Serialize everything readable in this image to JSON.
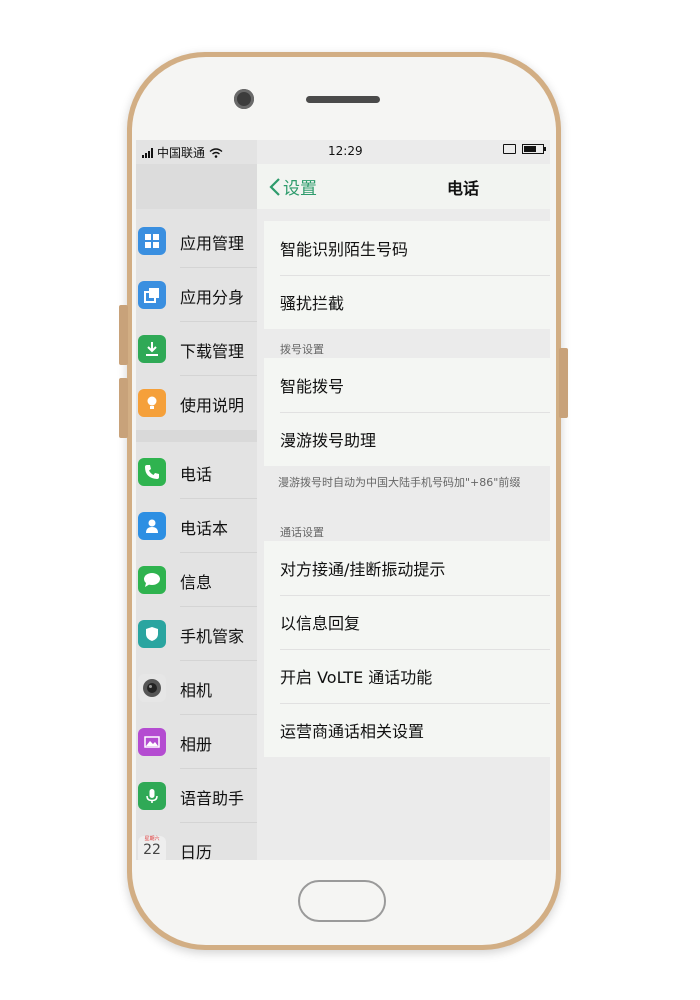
{
  "status_bar": {
    "carrier": "中国联通",
    "time": "12:29"
  },
  "sidebar": {
    "items": [
      {
        "label": "应用管理",
        "icon": "app-manager-icon",
        "color": "#3a8fe0"
      },
      {
        "label": "应用分身",
        "icon": "app-clone-icon",
        "color": "#3a8fe0"
      },
      {
        "label": "下载管理",
        "icon": "download-icon",
        "color": "#2fa956"
      },
      {
        "label": "使用说明",
        "icon": "lightbulb-icon",
        "color": "#f5a03a"
      },
      {
        "label": "电话",
        "icon": "phone-icon",
        "color": "#2fb34f"
      },
      {
        "label": "电话本",
        "icon": "contacts-icon",
        "color": "#2d8fe3"
      },
      {
        "label": "信息",
        "icon": "message-icon",
        "color": "#2fb34f"
      },
      {
        "label": "手机管家",
        "icon": "shield-icon",
        "color": "#2aa5a0"
      },
      {
        "label": "相机",
        "icon": "camera-icon",
        "color": "#555555"
      },
      {
        "label": "相册",
        "icon": "gallery-icon",
        "color": "#b44cd1"
      },
      {
        "label": "语音助手",
        "icon": "microphone-icon",
        "color": "#2fa956"
      },
      {
        "label": "日历",
        "icon": "calendar-icon",
        "color": "#eeeeee",
        "calendar_day": "22",
        "calendar_weekday": "星期六"
      }
    ]
  },
  "nav": {
    "back_label": "设置",
    "title": "电话"
  },
  "groups": {
    "top": [
      "智能识别陌生号码",
      "骚扰拦截"
    ],
    "dial_header": "拨号设置",
    "dial": [
      "智能拨号",
      "漫游拨号助理"
    ],
    "dial_hint": "漫游拨号时自动为中国大陆手机号码加\"+86\"前缀",
    "call_header": "通话设置",
    "call": [
      "对方接通/挂断振动提示",
      "以信息回复",
      "开启 VoLTE 通话功能",
      "运营商通话相关设置"
    ]
  },
  "colors": {
    "accent": "#2e9b6c",
    "frame": "#d2ae84"
  }
}
